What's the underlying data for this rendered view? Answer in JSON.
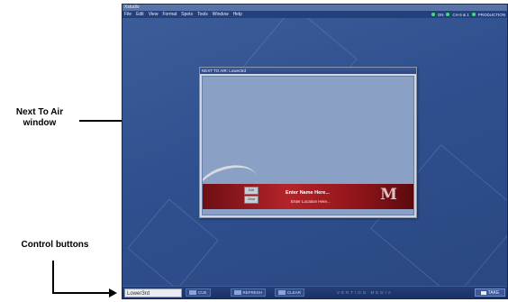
{
  "annotations": {
    "next_to_air_line1": "Next To Air",
    "next_to_air_line2": "window",
    "control_buttons": "Control buttons"
  },
  "app": {
    "title": "Xstudio",
    "menu": [
      "File",
      "Edit",
      "View",
      "Format",
      "Spots",
      "Tools",
      "Window",
      "Help"
    ],
    "status": [
      "ON",
      "CH 6 & 1",
      "PRODUCTION"
    ]
  },
  "next_to_air": {
    "title": "NEXT TO AIR: Lower3rd",
    "lower_third": {
      "name_placeholder": "Enter Name Here...",
      "location_placeholder": "Enter Location Here...",
      "logo_letter": "M",
      "btn_top": "Edit",
      "btn_bottom": "Clear"
    }
  },
  "controls": {
    "input_value": "Lower3rd",
    "cue_label": "CUE",
    "refresh_label": "REFRESH",
    "clear_label": "CLEAR",
    "brand": "VERTIGO MEDIA",
    "take_label": "TAKE"
  },
  "colors": {
    "desktop": "#2f4f8e",
    "lower_third_red": "#b3242a",
    "status_green": "#3ee06a"
  }
}
